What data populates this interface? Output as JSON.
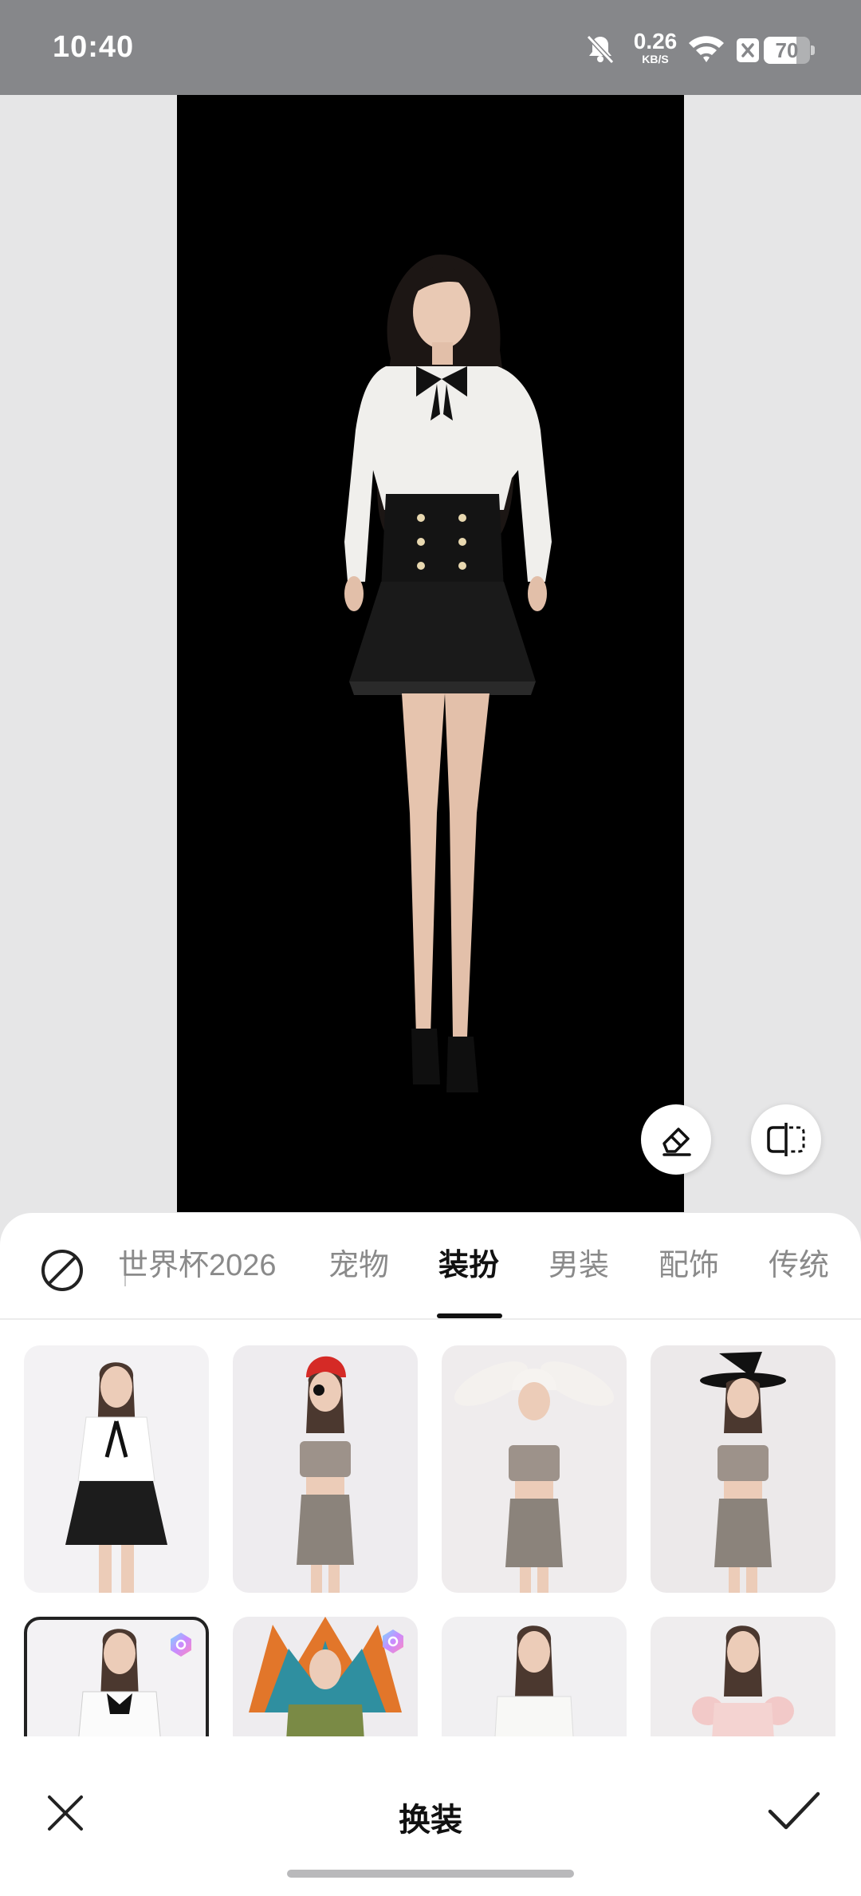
{
  "status_bar": {
    "time": "10:40",
    "net_speed_value": "0.26",
    "net_speed_unit": "KB/S",
    "battery_level": "70",
    "battery_fraction": 0.7,
    "icons": [
      "bell-off-icon",
      "wifi-icon",
      "sim-disabled-icon",
      "battery-icon"
    ]
  },
  "preview": {
    "tools": [
      "eraser-icon",
      "compare-icon"
    ]
  },
  "categories": {
    "tabs": [
      {
        "label": "世界杯2026",
        "active": false
      },
      {
        "label": "宠物",
        "active": false
      },
      {
        "label": "装扮",
        "active": true
      },
      {
        "label": "男装",
        "active": false
      },
      {
        "label": "配饰",
        "active": false
      },
      {
        "label": "传统",
        "active": false
      }
    ],
    "no_effect_icon": "no-effect-icon"
  },
  "outfits": [
    {
      "id": "ruffle-blouse-skirt",
      "premium": false,
      "selected": false
    },
    {
      "id": "pirate-hat",
      "premium": false,
      "selected": false
    },
    {
      "id": "bunny-hat",
      "premium": false,
      "selected": false
    },
    {
      "id": "witch-hat",
      "premium": false,
      "selected": false
    },
    {
      "id": "lace-collar-blouse",
      "premium": true,
      "selected": true
    },
    {
      "id": "feather-headdress",
      "premium": true,
      "selected": false
    },
    {
      "id": "white-knit-top",
      "premium": false,
      "selected": false
    },
    {
      "id": "pink-puff-top",
      "premium": false,
      "selected": false
    }
  ],
  "action_bar": {
    "title": "换装",
    "close_icon": "close-icon",
    "confirm_icon": "check-icon"
  }
}
